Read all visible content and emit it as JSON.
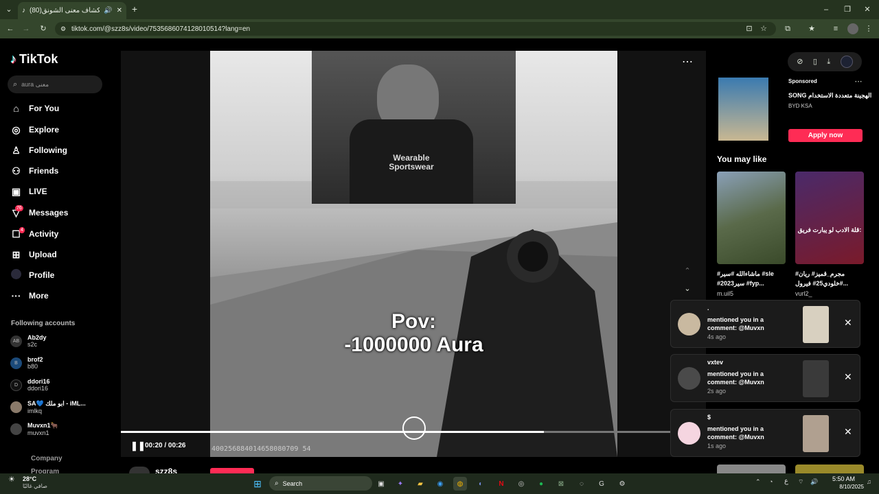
{
  "browser": {
    "tab_title": "(80)استكشاف معنى الشونق",
    "url": "tiktok.com/@szz8s/video/7535686074128010514?lang=en",
    "new_tab_icon": "plus-icon"
  },
  "sidebar": {
    "logo": "TikTok",
    "search_placeholder": "aura معنى",
    "items": [
      {
        "label": "For You",
        "icon": "home-icon"
      },
      {
        "label": "Explore",
        "icon": "compass-icon"
      },
      {
        "label": "Following",
        "icon": "following-icon"
      },
      {
        "label": "Friends",
        "icon": "friends-icon"
      },
      {
        "label": "LIVE",
        "icon": "live-icon"
      },
      {
        "label": "Messages",
        "icon": "messages-icon",
        "badge": "76"
      },
      {
        "label": "Activity",
        "icon": "activity-icon",
        "badge": "4"
      },
      {
        "label": "Upload",
        "icon": "upload-icon"
      },
      {
        "label": "Profile",
        "icon": "profile-icon"
      },
      {
        "label": "More",
        "icon": "more-icon"
      }
    ],
    "following_title": "Following accounts",
    "following": [
      {
        "name": "Ab2dy",
        "handle": "s2c",
        "avatar_text": "AB"
      },
      {
        "name": "brof2",
        "handle": "b80",
        "avatar_text": "B"
      },
      {
        "name": "ddori16",
        "handle": "ddori16",
        "avatar_text": "D"
      },
      {
        "name": "SA💙 ابو ملك - iML...",
        "handle": "imlkq",
        "avatar_text": ""
      },
      {
        "name": "Muvxn1🐂",
        "handle": "muvxn1",
        "avatar_text": ""
      }
    ],
    "footer": [
      "Company",
      "Program"
    ]
  },
  "video": {
    "overlay_line1": "Pov:",
    "overlay_line2": "-1000000 Aura",
    "watermark": "400256884014658080709 54",
    "time": "00:20 / 00:26",
    "progress": 0.77,
    "author": "szz8s",
    "shirt_text": "Wearable Sportswear"
  },
  "sponsored": {
    "label": "Sponsored",
    "title": "SONG الهجينة متعددة الاستخدام",
    "brand": "BYD KSA",
    "cta": "Apply now"
  },
  "you_may_like": {
    "title": "You may like",
    "cards": [
      {
        "caption": "#ماشاءالله #سير #sle #2023سير #fyp...",
        "author": "m.uil5"
      },
      {
        "caption": "مجرم_قميز# ريان# خلودي25# فيرول#...",
        "author": "vurl2_",
        "overlay": "قلة الادب لو يبارت فريق:"
      }
    ]
  },
  "notifications": [
    {
      "name": ".",
      "message": "mentioned you in a comment: @Muvxn",
      "time": "4s ago"
    },
    {
      "name": "vxtev",
      "message": "mentioned you in a comment: @Muvxn",
      "time": "2s ago"
    },
    {
      "name": "$",
      "message": "mentioned you in a comment: @Muvxn",
      "time": "1s ago"
    }
  ],
  "taskbar": {
    "weather_temp": "28°C",
    "weather_desc": "صافي غالبًا",
    "search_label": "Search",
    "time": "5:50 AM",
    "date": "8/10/2025",
    "lang": "ع"
  },
  "colors": {
    "accent": "#fe2c55",
    "browser_bg": "#34462c"
  }
}
